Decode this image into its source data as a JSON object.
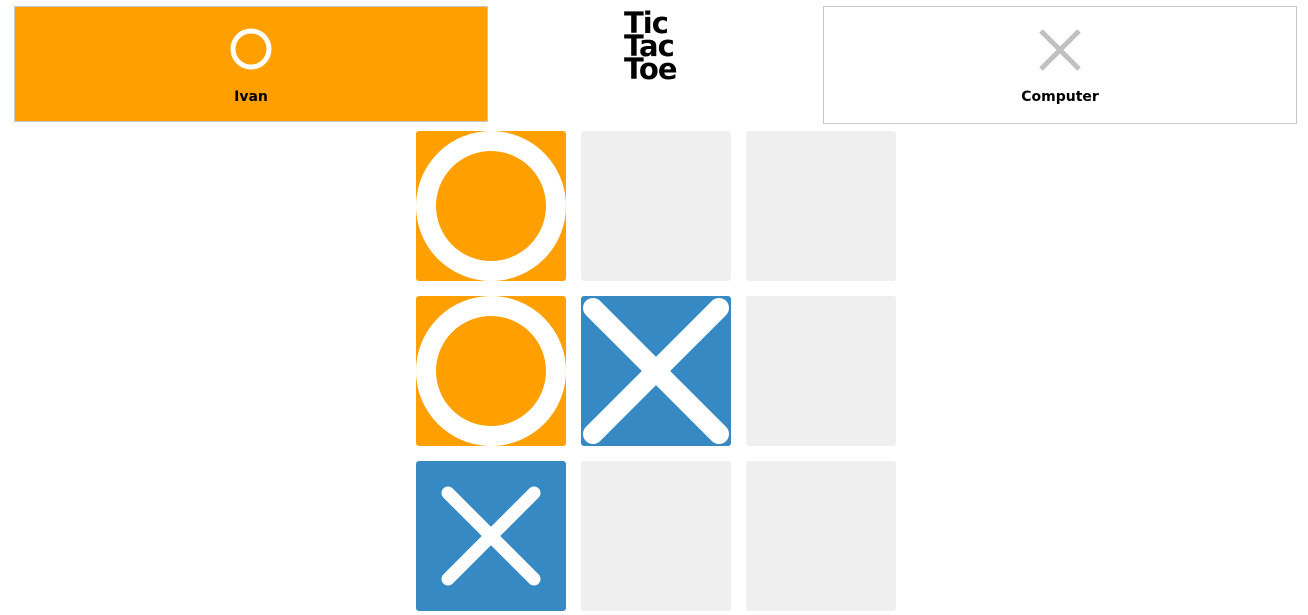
{
  "players": [
    {
      "name": "Ivan",
      "mark": "O",
      "mark_icon": "circle-icon",
      "active": true,
      "color": "#ff9f00"
    },
    {
      "name": "Computer",
      "mark": "X",
      "mark_icon": "cross-icon",
      "active": false,
      "color": "#c0c0c0"
    }
  ],
  "logo": {
    "line1": "Tic",
    "line2": "Tac",
    "line3": "Toe"
  },
  "board": {
    "cells": [
      "O",
      "",
      "",
      "O",
      "X",
      "",
      "X",
      "",
      ""
    ],
    "colors": {
      "O": "#ff9f00",
      "X": "#3689c3",
      "empty": "#efefef"
    }
  }
}
